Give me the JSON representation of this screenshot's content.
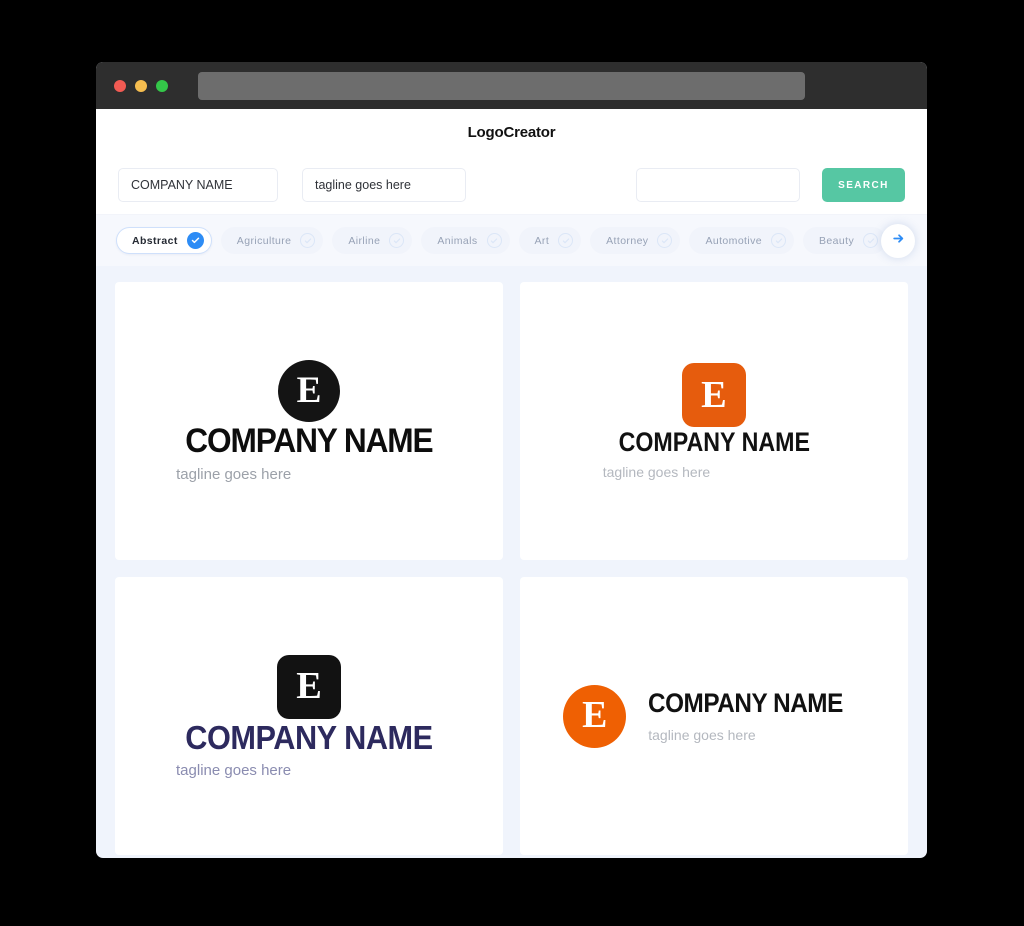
{
  "window": {
    "traffic_lights": [
      "close",
      "minimize",
      "maximize"
    ],
    "url_value": ""
  },
  "header": {
    "title": "LogoCreator"
  },
  "search": {
    "company_name_value": "COMPANY NAME",
    "company_name_placeholder": "COMPANY NAME",
    "tagline_value": "tagline goes here",
    "tagline_placeholder": "tagline goes here",
    "extra_value": "",
    "extra_placeholder": "",
    "search_button_label": "SEARCH"
  },
  "categories": {
    "next_icon": "arrow-right-icon",
    "items": [
      {
        "label": "Abstract",
        "selected": true,
        "icon": "check-circle-filled-icon"
      },
      {
        "label": "Agriculture",
        "selected": false,
        "icon": "check-circle-outline-icon"
      },
      {
        "label": "Airline",
        "selected": false,
        "icon": "check-circle-outline-icon"
      },
      {
        "label": "Animals",
        "selected": false,
        "icon": "check-circle-outline-icon"
      },
      {
        "label": "Art",
        "selected": false,
        "icon": "check-circle-outline-icon"
      },
      {
        "label": "Attorney",
        "selected": false,
        "icon": "check-circle-outline-icon"
      },
      {
        "label": "Automotive",
        "selected": false,
        "icon": "check-circle-outline-icon"
      },
      {
        "label": "Beauty",
        "selected": false,
        "icon": "check-circle-outline-icon"
      }
    ]
  },
  "results": {
    "cards": [
      {
        "layout": "stacked",
        "mark_shape": "circle",
        "mark_letter": "E",
        "mark_color": "#141414",
        "company_name": "COMPANY NAME",
        "company_color": "#0d0d0d",
        "tagline": "tagline goes here",
        "tagline_color": "#9ca1a9"
      },
      {
        "layout": "stacked",
        "mark_shape": "square",
        "mark_letter": "E",
        "mark_color": "#e65c0d",
        "company_name": "COMPANY NAME",
        "company_color": "#111111",
        "tagline": "tagline goes here",
        "tagline_color": "#b4b8bf"
      },
      {
        "layout": "stacked",
        "mark_shape": "square",
        "mark_letter": "E",
        "mark_color": "#121212",
        "company_name": "COMPANY NAME",
        "company_color": "#2d2a5e",
        "tagline": "tagline goes here",
        "tagline_color": "#8a8cb0"
      },
      {
        "layout": "horizontal",
        "mark_shape": "circle",
        "mark_letter": "E",
        "mark_color": "#ef6003",
        "company_name": "COMPANY NAME",
        "company_color": "#111111",
        "tagline": "tagline goes here",
        "tagline_color": "#b4b8bf"
      }
    ]
  },
  "colors": {
    "accent_green": "#56c7a3",
    "accent_blue": "#2d8cf5",
    "page_background": "#f0f4fc",
    "titlebar": "#2e2e2e"
  }
}
